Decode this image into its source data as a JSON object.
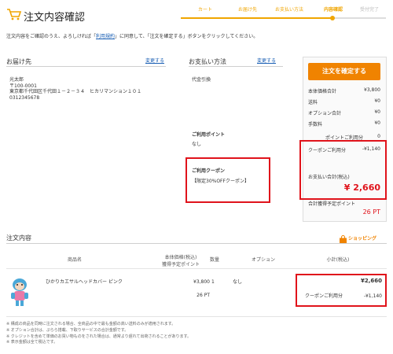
{
  "page_title": "注文内容確認",
  "steps": [
    {
      "label": "カート",
      "state": "done"
    },
    {
      "label": "お届け先",
      "state": "done"
    },
    {
      "label": "お支払い方法",
      "state": "done"
    },
    {
      "label": "内容確認",
      "state": "current"
    },
    {
      "label": "受付完了",
      "state": "todo"
    }
  ],
  "intro": {
    "before": "注文内容をご確認のうえ、よろしければ「",
    "link": "利用規約",
    "after": "」に同意して、「注文を確定する」ボタンをクリックしてください。"
  },
  "delivery": {
    "heading": "お届け先",
    "change": "変更する",
    "name": "光太郎",
    "postal": "〒100-0001",
    "address": "東京都千代田区千代田１－２－３４　ヒカリマンション１０１",
    "phone": "0312345678"
  },
  "payment": {
    "heading": "お支払い方法",
    "change": "変更する",
    "method": "代金引換",
    "points_heading": "ご利用ポイント",
    "points_value": "なし",
    "coupon_heading": "ご利用クーポン",
    "coupon_value": "【限定30%OFFクーポン】"
  },
  "summary": {
    "confirm_button": "注文を確定する",
    "rows": [
      {
        "label": "本体価格合計",
        "value": "¥3,800"
      },
      {
        "label": "送料",
        "value": "¥0"
      },
      {
        "label": "オプション合計",
        "value": "¥0"
      },
      {
        "label": "手数料",
        "value": "¥0"
      }
    ],
    "points_label": "ポイントご利用分",
    "points_value": "0",
    "coupon_label": "クーポンご利用分",
    "coupon_value": "-¥1,140",
    "total_label": "お支払い合計(税込)",
    "total_value": "¥ 2,660",
    "earn_label": "合計獲得予定ポイント",
    "earn_value": "26 PT"
  },
  "order": {
    "heading": "注文内容",
    "shopping_label": "ショッピング",
    "columns": {
      "name": "商品名",
      "price": "本体価格(税込)",
      "price2": "獲得予定ポイント",
      "qty": "数量",
      "option": "オプション",
      "subtotal": "小計(税込)"
    },
    "item": {
      "name": "ひかりカエサルヘッドカバー ピンク",
      "price": "¥3,800",
      "points": "26 PT",
      "qty": "1",
      "option": "なし",
      "subtotal": "¥2,660",
      "coupon_label": "クーポンご利用分",
      "coupon_value": "-¥1,140"
    }
  },
  "notes": [
    "構成の商品を同時に注文される場合、全商品の中で最も金額の高い送料のみが適用されます。",
    "オプション合計は、ぷらら搭載、下取りサービスの合計金額です。",
    "クレジットを含めて単価のお買い物ものをされた場合は、通常より遅れて出荷されることがあります。",
    "表示金額は全て税込です。"
  ],
  "colors": {
    "accent": "#f08300",
    "price_red": "#e0131b",
    "link": "#1a5fb4",
    "highlight_box": "#e0131b"
  },
  "icons": {
    "cart": "cart-icon",
    "bag": "shopping-bag-icon",
    "product": "mascot-headcover-image"
  }
}
